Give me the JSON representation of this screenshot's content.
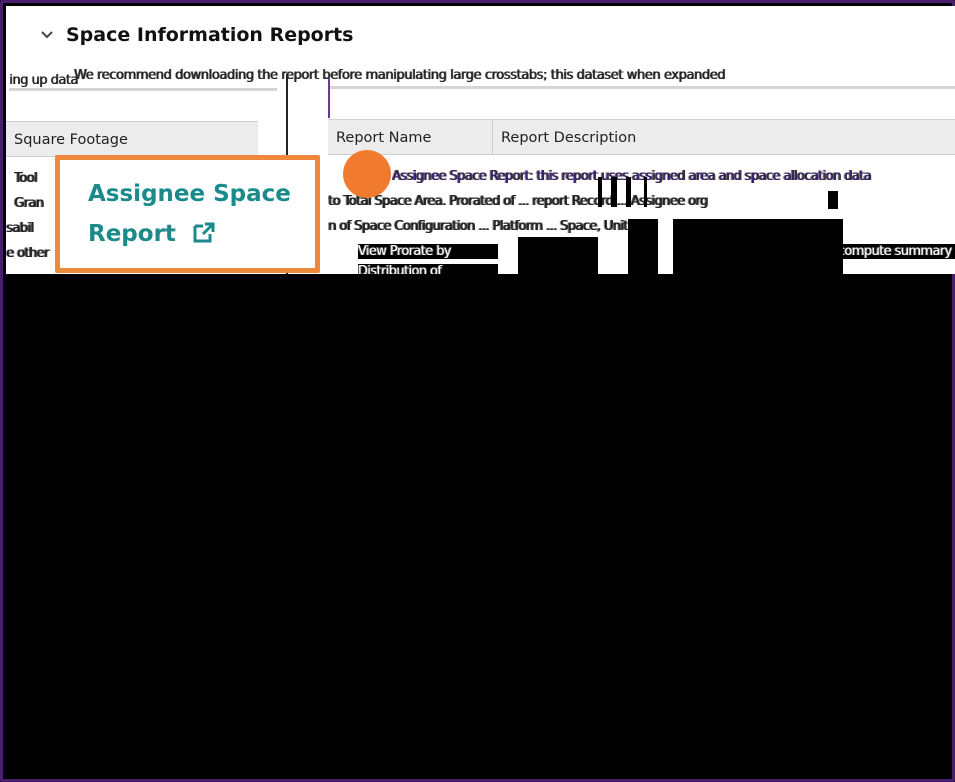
{
  "section": {
    "title": "Space Information Reports",
    "intro_text": "We recommend downloading the report before manipulating large crosstabs; this dataset when expanded",
    "intro_left_text": "ing up data"
  },
  "left_table": {
    "header": "Square Footage",
    "row_fragments": [
      "Tool",
      "Gran",
      "sabil",
      "e other"
    ]
  },
  "right_table": {
    "headers": [
      "Report Name",
      "Report Description"
    ],
    "row_fragments": [
      "Assignee Space Report: this report uses assigned area and space allocation data",
      "to Total Space Area. Prorated of ... report Record ... Assignee org",
      "n of Space Configuration ... Platform ... Space, Unit",
      "View Prorate by",
      "Distribution of",
      "compute summary"
    ]
  },
  "callout": {
    "link_text": "Assignee Space Report",
    "link_line1": "Assignee Space",
    "link_line2": "Report",
    "icon": "external-link-icon"
  },
  "colors": {
    "frame_border": "#4a1d6e",
    "callout_border": "#f0883c",
    "link": "#1a8a8a",
    "marker_dot": "#f07a2e",
    "header_bg": "#ececec"
  }
}
